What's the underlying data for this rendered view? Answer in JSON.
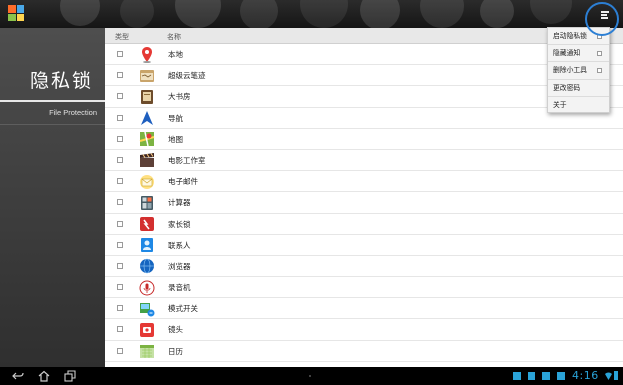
{
  "left_panel": {
    "title": "隐私锁",
    "nav_item": "File Protection"
  },
  "list": {
    "header_type": "类型",
    "header_name": "名称",
    "rows": [
      {
        "name": "本地",
        "icon": "map-pin-icon"
      },
      {
        "name": "超级云笔迹",
        "icon": "notebook-icon"
      },
      {
        "name": "大书房",
        "icon": "book-icon"
      },
      {
        "name": "导航",
        "icon": "navigation-arrow-icon"
      },
      {
        "name": "地图",
        "icon": "maps-icon"
      },
      {
        "name": "电影工作室",
        "icon": "clapperboard-icon"
      },
      {
        "name": "电子邮件",
        "icon": "envelope-icon"
      },
      {
        "name": "计算器",
        "icon": "calculator-icon"
      },
      {
        "name": "家长锁",
        "icon": "parental-lock-icon"
      },
      {
        "name": "联系人",
        "icon": "contacts-icon"
      },
      {
        "name": "浏览器",
        "icon": "globe-icon"
      },
      {
        "name": "录音机",
        "icon": "microphone-icon"
      },
      {
        "name": "模式开关",
        "icon": "mode-switch-icon"
      },
      {
        "name": "镜头",
        "icon": "camera-icon"
      },
      {
        "name": "日历",
        "icon": "calendar-icon"
      }
    ]
  },
  "menu": {
    "items": [
      {
        "label": "启动隐私锁",
        "has_checkbox": true
      },
      {
        "label": "隐藏通知",
        "has_checkbox": true
      },
      {
        "label": "删除小工具",
        "has_checkbox": true
      },
      {
        "label": "更改密码",
        "has_checkbox": false
      },
      {
        "label": "关于",
        "has_checkbox": false
      }
    ]
  },
  "status": {
    "clock": "4:16"
  },
  "colors": {
    "accent": "#2aa3d8",
    "highlight_ring": "#2c7fd4"
  }
}
